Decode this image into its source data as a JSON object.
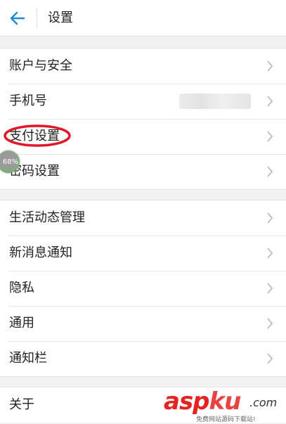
{
  "header": {
    "title": "设置"
  },
  "groups": [
    {
      "items": [
        {
          "label": "账户与安全"
        },
        {
          "label": "手机号"
        },
        {
          "label": "支付设置"
        },
        {
          "label": "密码设置"
        }
      ]
    },
    {
      "items": [
        {
          "label": "生活动态管理"
        },
        {
          "label": "新消息通知"
        },
        {
          "label": "隐私"
        },
        {
          "label": "通用"
        },
        {
          "label": "通知栏"
        }
      ]
    },
    {
      "items": [
        {
          "label": "关于"
        }
      ]
    }
  ],
  "overlay": {
    "badge_text": "68%",
    "highlight_color": "#e0192a"
  },
  "watermark": {
    "asp": "asp",
    "ku": "ku",
    "com": ".com",
    "subtitle": "免费网站源码下载站!"
  },
  "colors": {
    "accent": "#1e88d8",
    "highlight": "#e0192a"
  }
}
